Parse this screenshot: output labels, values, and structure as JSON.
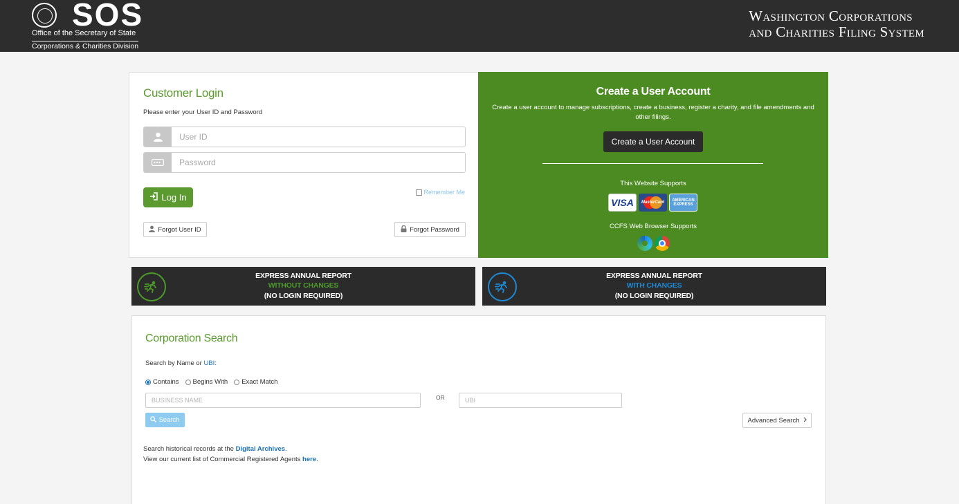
{
  "header": {
    "logo_text": "SOS",
    "logo_line1": "Office of the Secretary of State",
    "logo_line2": "Corporations & Charities Division",
    "system_title_line1": "Washington Corporations",
    "system_title_line2": "and Charities Filing System"
  },
  "login": {
    "title": "Customer Login",
    "subtitle": "Please enter your User ID and Password",
    "userid_placeholder": "User ID",
    "password_placeholder": "Password",
    "login_label": "Log In",
    "remember_label": "Remember Me",
    "forgot_userid_label": "Forgot User ID",
    "forgot_password_label": "Forgot Password"
  },
  "create": {
    "title": "Create a User Account",
    "description": "Create a user account to manage subscriptions, create a business, register a charity, and file amendments and other filings.",
    "button_label": "Create a User Account",
    "website_supports": "This Website Supports",
    "cards": [
      "VISA",
      "MasterCard",
      "AMERICAN EXPRESS"
    ],
    "browser_supports": "CCFS Web Browser Supports"
  },
  "express": [
    {
      "line1": "EXPRESS ANNUAL REPORT",
      "line2": "WITHOUT CHANGES",
      "line3": "(NO LOGIN REQUIRED)",
      "accent": "#4c9a2a"
    },
    {
      "line1": "EXPRESS ANNUAL REPORT",
      "line2": "WITH CHANGES",
      "line3": "(NO LOGIN REQUIRED)",
      "accent": "#1e88d2"
    }
  ],
  "search": {
    "title": "Corporation Search",
    "subtitle_prefix": "Search by Name or ",
    "subtitle_ubi": "UBI",
    "subtitle_suffix": ":",
    "options": [
      "Contains",
      "Begins With",
      "Exact Match"
    ],
    "business_placeholder": "BUSINESS NAME",
    "or_label": "OR",
    "ubi_placeholder": "UBI",
    "search_label": "Search",
    "advanced_label": "Advanced Search",
    "hist1_prefix": "Search historical records at the ",
    "hist1_link": "Digital Archives",
    "hist1_suffix": ".",
    "hist2_prefix": "View our current list of Commercial Registered Agents ",
    "hist2_link": "here",
    "hist2_suffix": "."
  }
}
